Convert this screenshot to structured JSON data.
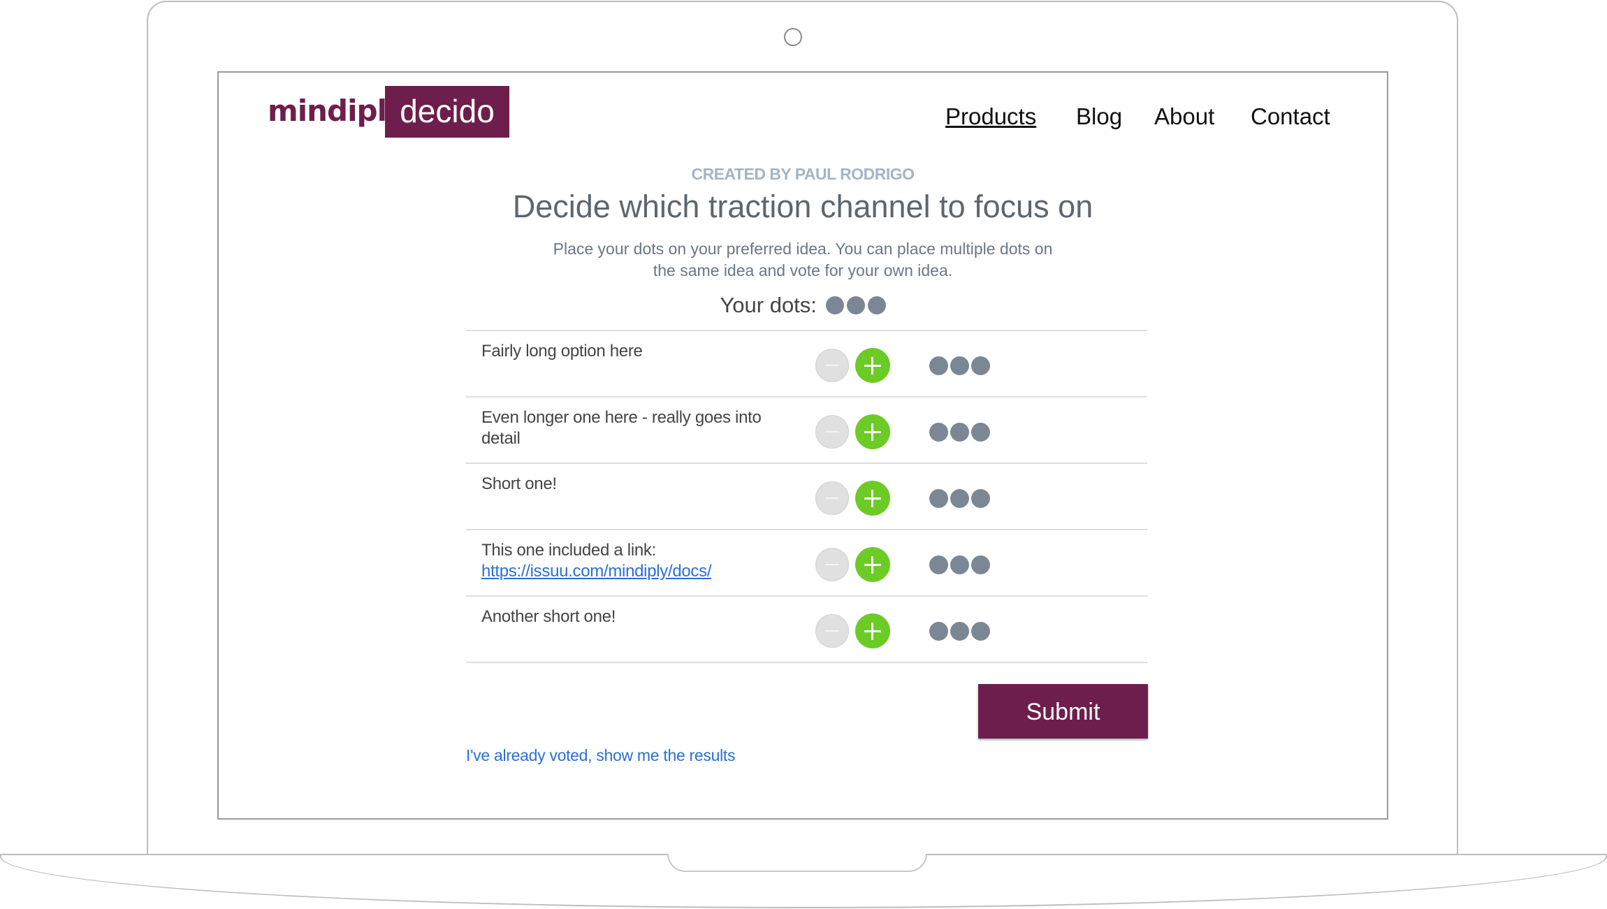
{
  "brand": {
    "name": "mindiply",
    "product": "decido",
    "color": "#6e1e4c"
  },
  "nav": {
    "items": [
      {
        "label": "Products",
        "active": true
      },
      {
        "label": "Blog",
        "active": false
      },
      {
        "label": "About",
        "active": false
      },
      {
        "label": "Contact",
        "active": false
      }
    ]
  },
  "header": {
    "creator": "CREATED BY PAUL RODRIGO",
    "title": "Decide which traction channel to focus on",
    "subtitle": "Place your dots on your preferred idea. You can place multiple dots on the same idea and vote for your own idea.",
    "your_dots_label": "Your dots:",
    "your_dots_count": 3
  },
  "options": [
    {
      "text": "Fairly long option here",
      "link": "",
      "dots": 3
    },
    {
      "text": "Even longer one here - really goes into detail",
      "link": "",
      "dots": 3
    },
    {
      "text": "Short one!",
      "link": "",
      "dots": 3
    },
    {
      "text": "This one included a link: ",
      "link": "https://issuu.com/mindiply/docs/",
      "dots": 3
    },
    {
      "text": "Another short one!",
      "link": "",
      "dots": 3
    }
  ],
  "actions": {
    "submit_label": "Submit",
    "results_link": "I've already voted, show me the results"
  },
  "colors": {
    "plus": "#6ccb25",
    "minus": "#e0e0e0",
    "dot": "#7b8794",
    "link": "#2a6fd6"
  }
}
